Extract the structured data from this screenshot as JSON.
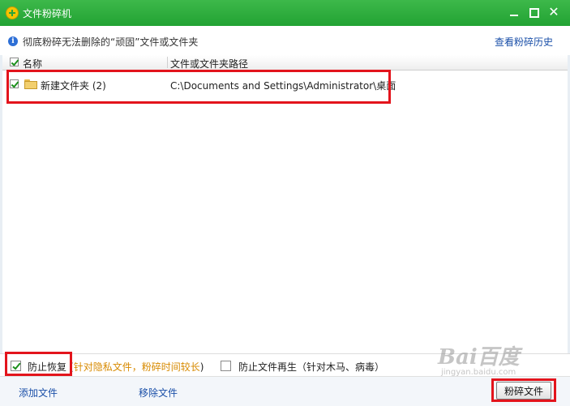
{
  "window": {
    "title": "文件粉碎机"
  },
  "infobar": {
    "text": "彻底粉碎无法删除的“顽固”文件或文件夹",
    "history_link": "查看粉碎历史"
  },
  "table": {
    "columns": [
      "名称",
      "文件或文件夹路径"
    ],
    "rows": [
      {
        "checked": true,
        "name": "新建文件夹 (2)",
        "path": "C:\\Documents and Settings\\Administrator\\桌面",
        "icon": "folder-icon"
      }
    ]
  },
  "options": {
    "prevent_recovery": {
      "checked": true,
      "label": "防止恢复",
      "note": "针对隐私文件，粉碎时间较长"
    },
    "prevent_regen": {
      "checked": false,
      "label": "防止文件再生（针对木马、病毒）"
    }
  },
  "footer": {
    "add_label": "添加文件",
    "remove_label": "移除文件",
    "shred_label": "粉碎文件"
  },
  "watermark": {
    "logo": "Bai百度",
    "url": "jingyan.baidu.com"
  },
  "colors": {
    "titlebar": "#22a333",
    "link": "#1a4fa8",
    "note": "#d78a00",
    "highlight": "#e3141c"
  }
}
